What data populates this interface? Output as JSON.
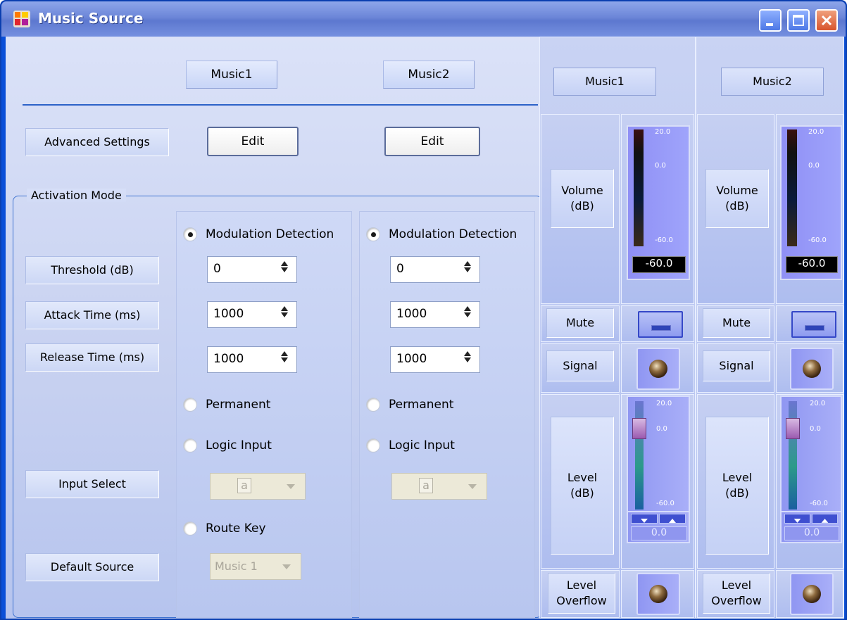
{
  "window": {
    "title": "Music Source",
    "minimize_icon": "minimize-icon",
    "maximize_icon": "maximize-icon",
    "close_icon": "close-icon"
  },
  "left_panel": {
    "columns": [
      "Music1",
      "Music2"
    ],
    "advanced_settings_label": "Advanced Settings",
    "edit_label": "Edit",
    "activation_mode_label": "Activation Mode",
    "row_labels": {
      "threshold": "Threshold (dB)",
      "attack": "Attack Time (ms)",
      "release": "Release Time (ms)",
      "input_select": "Input Select",
      "default_source": "Default Source"
    },
    "channels": [
      {
        "modulation_label": "Modulation Detection",
        "modulation_checked": true,
        "threshold": "0",
        "attack": "1000",
        "release": "1000",
        "permanent_label": "Permanent",
        "logic_input_label": "Logic Input",
        "input_select_value": "a",
        "route_key_label": "Route Key",
        "default_source_value": "Music 1"
      },
      {
        "modulation_label": "Modulation Detection",
        "modulation_checked": true,
        "threshold": "0",
        "attack": "1000",
        "release": "1000",
        "permanent_label": "Permanent",
        "logic_input_label": "Logic Input",
        "input_select_value": "a"
      }
    ]
  },
  "mixer": {
    "channels": [
      {
        "name": "Music1",
        "volume_label": "Volume\n(dB)",
        "meter_scale": [
          "20.0",
          "0.0",
          "-60.0"
        ],
        "meter_reading": "-60.0",
        "mute_label": "Mute",
        "signal_label": "Signal",
        "level_label": "Level\n(dB)",
        "fader_scale": [
          "20.0",
          "0.0",
          "-60.0"
        ],
        "fader_reading": "0.0",
        "overflow_label": "Level\nOverflow"
      },
      {
        "name": "Music2",
        "volume_label": "Volume\n(dB)",
        "meter_scale": [
          "20.0",
          "0.0",
          "-60.0"
        ],
        "meter_reading": "-60.0",
        "mute_label": "Mute",
        "signal_label": "Signal",
        "level_label": "Level\n(dB)",
        "fader_scale": [
          "20.0",
          "0.0",
          "-60.0"
        ],
        "fader_reading": "0.0",
        "overflow_label": "Level\nOverflow"
      }
    ]
  }
}
